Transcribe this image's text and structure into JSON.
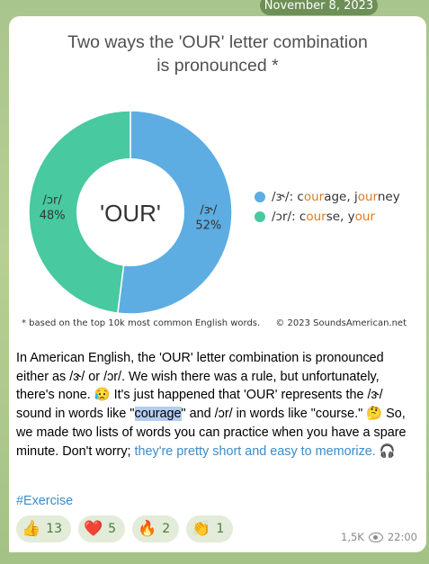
{
  "date": "November 8, 2023",
  "chart": {
    "title_line1": "Two ways the 'OUR' letter combination",
    "title_line2": "is pronounced *",
    "center_label": "'OUR'",
    "footnote": "* based on the top 10k most common English words.",
    "copyright": "© 2023 SoundsAmerican.net"
  },
  "chart_data": {
    "type": "pie",
    "title": "Two ways the 'OUR' letter combination is pronounced *",
    "series": [
      {
        "name": "/ɝ/",
        "value": 52,
        "label": "/ɝ/",
        "pct": "52%",
        "color": "#5dade2"
      },
      {
        "name": "/ɔr/",
        "value": 48,
        "label": "/ɔr/",
        "pct": "48%",
        "color": "#48c9a0"
      }
    ],
    "legend": [
      {
        "symbol": "/ɝ/: ",
        "w1_pre": "c",
        "w1_hl": "our",
        "w1_post": "age, ",
        "w2_pre": "j",
        "w2_hl": "our",
        "w2_post": "ney",
        "color": "#5dade2"
      },
      {
        "symbol": "/ɔr/: ",
        "w1_pre": "c",
        "w1_hl": "our",
        "w1_post": "se, ",
        "w2_pre": "y",
        "w2_hl": "our",
        "w2_post": "",
        "color": "#48c9a0"
      }
    ],
    "legend_position": "right"
  },
  "message": {
    "t1": "In American English, the 'OUR' letter combination is pronounced either as /ɝ/ or /ɔr/. We wish there was a rule, but unfortunately, there's none. ",
    "e1": "😥",
    "t2": " It's just happened that 'OUR' represents the /ɝ/ sound in words like \"",
    "sel": "courage",
    "t3": "\" and /ɔr/ in words like \"course.\" ",
    "e2": "🤔",
    "t4": " So, we made two lists of words you can practice when you have a spare minute. Don't worry; ",
    "link": "they're pretty short and easy to memorize.",
    "e3": "🎧"
  },
  "hashtag": "#Exercise",
  "reactions": [
    {
      "emoji": "👍",
      "count": "13",
      "icon": "thumbs-up-icon"
    },
    {
      "emoji": "❤️",
      "count": "5",
      "icon": "heart-icon"
    },
    {
      "emoji": "🔥",
      "count": "2",
      "icon": "fire-icon"
    },
    {
      "emoji": "👏",
      "count": "1",
      "icon": "clap-icon"
    }
  ],
  "views": "1,5K",
  "time": "22:00"
}
